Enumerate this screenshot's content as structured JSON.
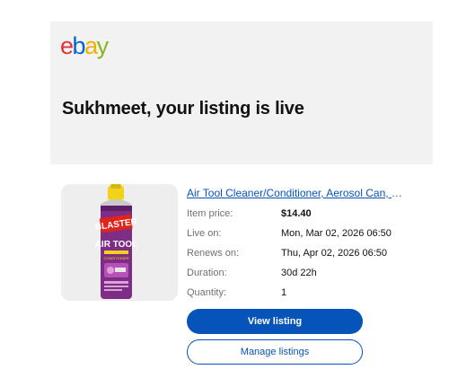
{
  "brand": {
    "logo_letters": [
      "e",
      "b",
      "a",
      "y"
    ],
    "logo_colors": [
      "#e53238",
      "#0064d2",
      "#f5af02",
      "#86b817"
    ]
  },
  "header": {
    "title": "Sukhmeet, your listing is live"
  },
  "listing": {
    "title": "Air Tool Cleaner/Conditioner, Aerosol Can, 11...",
    "product_image": {
      "brand_text": "BLASTER",
      "product_text": "AIR TOOL",
      "sub_text": "CONDITIONER"
    },
    "details": [
      {
        "label": "Item price:",
        "value": "$14.40",
        "bold": true
      },
      {
        "label": "Live on:",
        "value": "Mon, Mar 02, 2026 06:50"
      },
      {
        "label": "Renews on:",
        "value": "Thu, Apr 02, 2026 06:50"
      },
      {
        "label": "Duration:",
        "value": "30d 22h"
      },
      {
        "label": "Quantity:",
        "value": "1"
      }
    ]
  },
  "actions": {
    "view_listing": "View listing",
    "manage_listings": "Manage listings"
  },
  "colors": {
    "accent": "#0654ba",
    "panel": "#f2f2f2"
  }
}
